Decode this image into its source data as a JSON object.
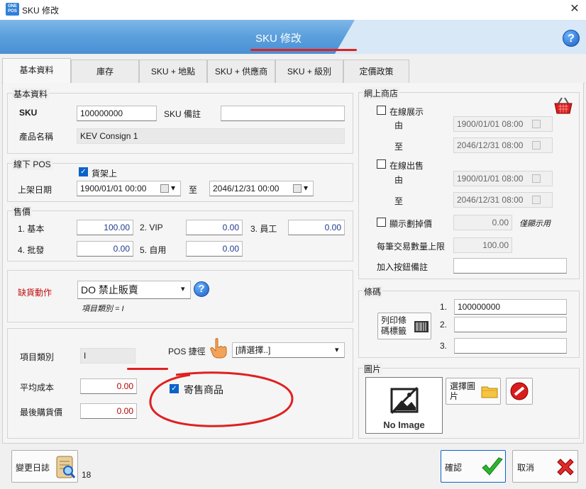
{
  "window": {
    "title": "SKU 修改",
    "app_icon_text": "ONE POS",
    "close": "✕"
  },
  "banner": {
    "title": "SKU 修改",
    "help": "?"
  },
  "tabs": [
    {
      "label": "基本資料",
      "active": true
    },
    {
      "label": "庫存"
    },
    {
      "label": "SKU + 地點"
    },
    {
      "label": "SKU + 供應商"
    },
    {
      "label": "SKU + 級別"
    },
    {
      "label": "定價政策"
    }
  ],
  "basic": {
    "group_label": "基本資料",
    "sku_label": "SKU",
    "sku_value": "100000000",
    "sku_note_label": "SKU 備註",
    "sku_note_value": "",
    "name_label": "產品名稱",
    "name_value": "KEV Consign 1"
  },
  "offline": {
    "group_label": "線下 POS",
    "shelf_label": "貨架上",
    "shelf_checked": true,
    "date_label": "上架日期",
    "date_from": "1900/01/01 00:00",
    "to_label": "至",
    "date_to": "2046/12/31 00:00"
  },
  "price": {
    "group_label": "售價",
    "items": [
      {
        "label": "1. 基本",
        "value": "100.00"
      },
      {
        "label": "2. VIP",
        "value": "0.00"
      },
      {
        "label": "3. 員工",
        "value": "0.00"
      },
      {
        "label": "4. 批發",
        "value": "0.00"
      },
      {
        "label": "5. 自用",
        "value": "0.00"
      }
    ]
  },
  "shortage": {
    "label": "缺貨動作",
    "value": "DO 禁止販賣",
    "note": "項目類別 = I",
    "help": "?"
  },
  "item": {
    "type_label": "項目類別",
    "type_value": "I",
    "pos_shortcut_label": "POS 捷徑",
    "pos_shortcut_value": "[請選擇..]",
    "avg_cost_label": "平均成本",
    "avg_cost_value": "0.00",
    "last_price_label": "最後購貨價",
    "last_price_value": "0.00",
    "consign_label": "寄售商品",
    "consign_checked": true
  },
  "online": {
    "group_label": "網上商店",
    "display_label": "在線展示",
    "from_label": "由",
    "to_label": "至",
    "display_from": "1900/01/01 08:00",
    "display_to": "2046/12/31 08:00",
    "sale_label": "在線出售",
    "sale_from": "1900/01/01 08:00",
    "sale_to": "2046/12/31 08:00",
    "strike_label": "顯示劃掉價",
    "strike_value": "0.00",
    "strike_note": "僅顯示用",
    "max_qty_label": "每筆交易數量上限",
    "max_qty_value": "100.00",
    "cart_note_label": "加入按鈕備註",
    "cart_note_value": ""
  },
  "barcode": {
    "group_label": "條碼",
    "print_label": "列印條碼標籤",
    "rows": [
      {
        "no": "1.",
        "value": "100000000"
      },
      {
        "no": "2.",
        "value": ""
      },
      {
        "no": "3.",
        "value": ""
      }
    ]
  },
  "image": {
    "group_label": "圖片",
    "placeholder": "No Image",
    "choose_label": "選擇圖片"
  },
  "footer": {
    "log_label": "變更日誌",
    "log_count": "18",
    "confirm_label": "確認",
    "cancel_label": "取消"
  },
  "colors": {
    "accent": "#0a63c9",
    "banner": "#5a9fdc",
    "annotation": "#e02020",
    "price_text": "#1f3a8a",
    "cost_text": "#b40000"
  }
}
